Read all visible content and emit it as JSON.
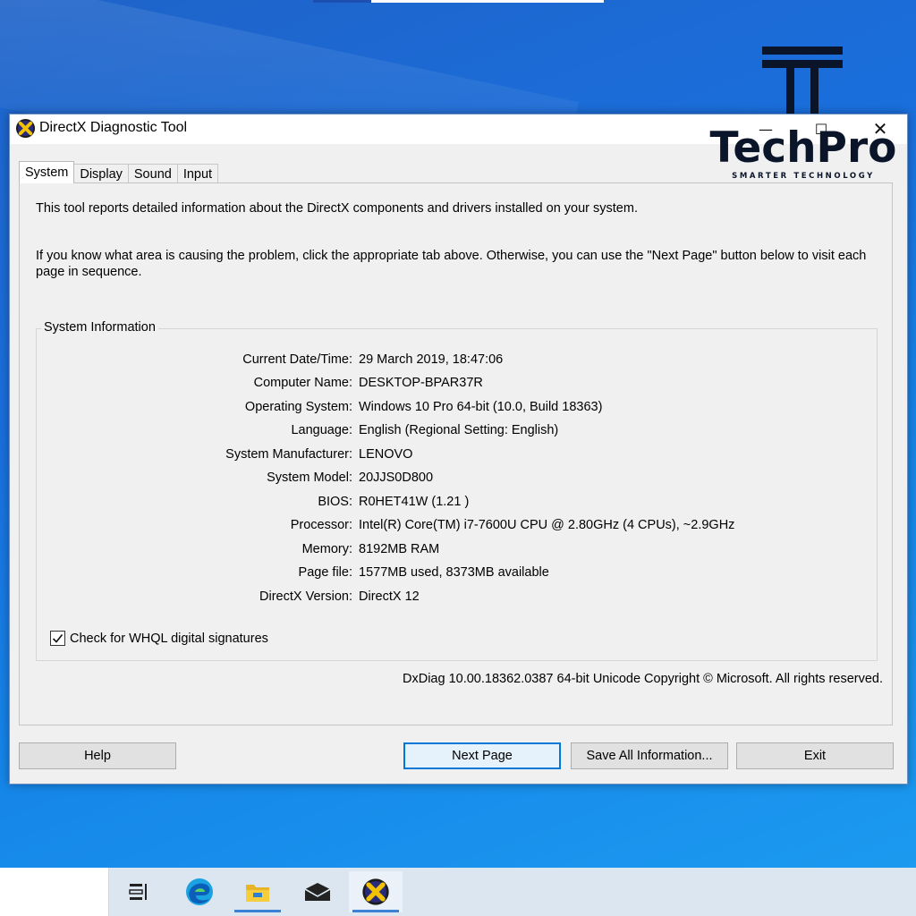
{
  "window": {
    "title": "DirectX Diagnostic Tool",
    "minimize_glyph": "—",
    "maximize_glyph": "☐",
    "close_glyph": "✕"
  },
  "tabs": [
    {
      "label": "System",
      "active": true
    },
    {
      "label": "Display",
      "active": false
    },
    {
      "label": "Sound",
      "active": false
    },
    {
      "label": "Input",
      "active": false
    }
  ],
  "intro": {
    "line1": "This tool reports detailed information about the DirectX components and drivers installed on your system.",
    "line2": "If you know what area is causing the problem, click the appropriate tab above.  Otherwise, you can use the \"Next Page\" button below to visit each page in sequence."
  },
  "system_info": {
    "legend": "System Information",
    "rows": [
      {
        "label": "Current Date/Time:",
        "value": "29 March 2019, 18:47:06"
      },
      {
        "label": "Computer Name:",
        "value": "DESKTOP-BPAR37R"
      },
      {
        "label": "Operating System:",
        "value": "Windows 10 Pro 64-bit (10.0, Build 18363)"
      },
      {
        "label": "Language:",
        "value": "English (Regional Setting: English)"
      },
      {
        "label": "System Manufacturer:",
        "value": "LENOVO"
      },
      {
        "label": "System Model:",
        "value": "20JJS0D800"
      },
      {
        "label": "BIOS:",
        "value": "R0HET41W (1.21 )"
      },
      {
        "label": "Processor:",
        "value": "Intel(R) Core(TM) i7-7600U CPU @ 2.80GHz (4 CPUs), ~2.9GHz"
      },
      {
        "label": "Memory:",
        "value": "8192MB RAM"
      },
      {
        "label": "Page file:",
        "value": "1577MB used, 8373MB available"
      },
      {
        "label": "DirectX Version:",
        "value": "DirectX 12"
      }
    ],
    "whql_label": "Check for WHQL digital signatures",
    "whql_checked": true
  },
  "footer_text": "DxDiag 10.00.18362.0387 64-bit Unicode  Copyright © Microsoft. All rights reserved.",
  "buttons": {
    "help": "Help",
    "next_page": "Next Page",
    "save_all": "Save All Information...",
    "exit": "Exit"
  },
  "logo": {
    "word": "TechPro",
    "tagline": "SMARTER TECHNOLOGY"
  },
  "taskbar": {
    "icons": [
      "task-view-icon",
      "edge-icon",
      "file-explorer-icon",
      "mail-icon",
      "directx-icon"
    ],
    "active_icon": "directx-icon"
  },
  "colors": {
    "desktop_blue": "#1a6fdd",
    "window_bg": "#f0f0f0",
    "focus_border": "#0078d7",
    "logo_dark": "#0b1529"
  }
}
